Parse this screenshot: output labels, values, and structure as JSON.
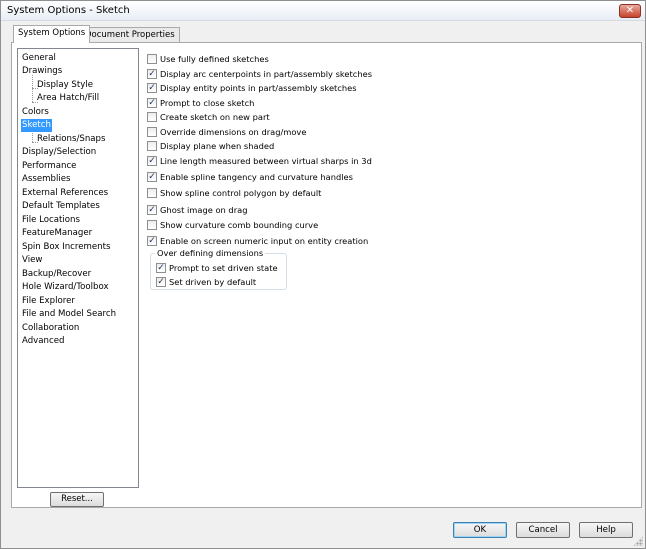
{
  "window": {
    "title": "System Options - Sketch",
    "close_glyph": "✕"
  },
  "tabs": [
    {
      "label": "System Options",
      "active": true
    },
    {
      "label": "Document Properties",
      "active": false
    }
  ],
  "tree": {
    "items": [
      {
        "label": "General"
      },
      {
        "label": "Drawings"
      },
      {
        "label": "Display Style"
      },
      {
        "label": "Area Hatch/Fill"
      },
      {
        "label": "Colors"
      },
      {
        "label": "Sketch",
        "selected": true
      },
      {
        "label": "Relations/Snaps"
      },
      {
        "label": "Display/Selection"
      },
      {
        "label": "Performance"
      },
      {
        "label": "Assemblies"
      },
      {
        "label": "External References"
      },
      {
        "label": "Default Templates"
      },
      {
        "label": "File Locations"
      },
      {
        "label": "FeatureManager"
      },
      {
        "label": "Spin Box Increments"
      },
      {
        "label": "View"
      },
      {
        "label": "Backup/Recover"
      },
      {
        "label": "Hole Wizard/Toolbox"
      },
      {
        "label": "File Explorer"
      },
      {
        "label": "File and Model Search"
      },
      {
        "label": "Collaboration"
      },
      {
        "label": "Advanced"
      }
    ],
    "reset_label": "Reset..."
  },
  "options": [
    {
      "label": "Use fully defined sketches",
      "checked": false
    },
    {
      "label": "Display arc centerpoints in part/assembly sketches",
      "checked": true
    },
    {
      "label": "Display entity points in part/assembly sketches",
      "checked": true
    },
    {
      "label": "Prompt to close sketch",
      "checked": true
    },
    {
      "label": "Create sketch on new part",
      "checked": false
    },
    {
      "label": "Override dimensions on drag/move",
      "checked": false
    },
    {
      "label": "Display plane when shaded",
      "checked": false
    },
    {
      "label": "Line length measured between virtual sharps in 3d",
      "checked": true
    },
    {
      "label": "Enable spline tangency and curvature handles",
      "checked": true
    },
    {
      "label": "Show spline control polygon by default",
      "checked": false
    },
    {
      "label": "Ghost image on drag",
      "checked": true
    },
    {
      "label": "Show curvature comb bounding curve",
      "checked": false
    },
    {
      "label": "Enable on screen numeric input on entity creation",
      "checked": true
    }
  ],
  "over_defining": {
    "legend": "Over defining dimensions",
    "options": [
      {
        "label": "Prompt to set driven state",
        "checked": true
      },
      {
        "label": "Set driven by default",
        "checked": true
      }
    ]
  },
  "buttons": {
    "ok": "OK",
    "cancel": "Cancel",
    "help": "Help"
  },
  "check_glyph": "✓"
}
